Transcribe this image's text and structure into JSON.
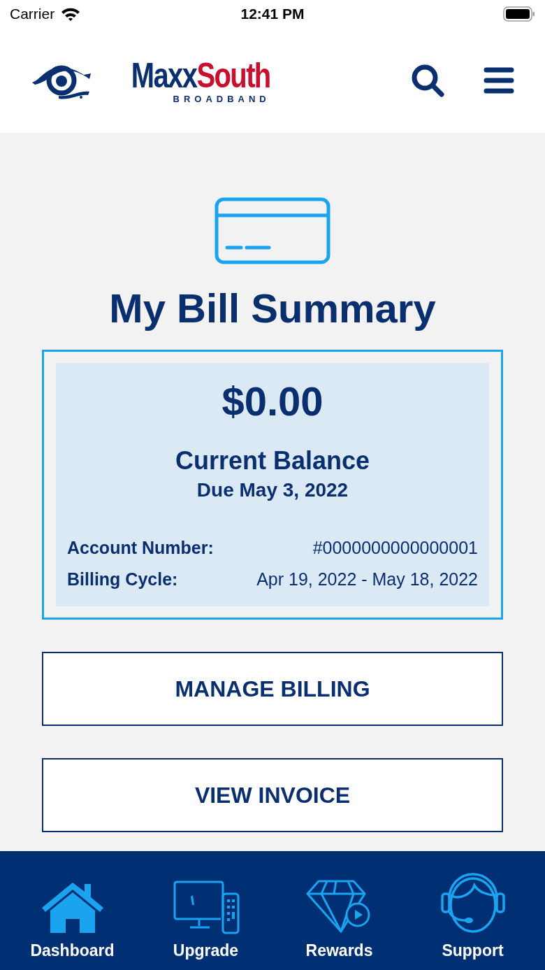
{
  "status_bar": {
    "carrier": "Carrier",
    "time": "12:41 PM"
  },
  "header": {
    "logo": {
      "word_1": "Maxx",
      "word_2": "South",
      "tagline": "BROADBAND"
    }
  },
  "bill": {
    "title": "My Bill Summary",
    "amount": "$0.00",
    "balance_label": "Current Balance",
    "due": "Due May 3, 2022",
    "details": [
      {
        "label": "Account Number:",
        "value": "#0000000000000001"
      },
      {
        "label": "Billing Cycle:",
        "value": "Apr 19, 2022 - May 18, 2022"
      }
    ]
  },
  "actions": [
    "MANAGE BILLING",
    "VIEW INVOICE"
  ],
  "tab_bar": [
    {
      "label": "Dashboard",
      "kind": "home"
    },
    {
      "label": "Upgrade",
      "kind": "tv"
    },
    {
      "label": "Rewards",
      "kind": "gem"
    },
    {
      "label": "Support",
      "kind": "agent"
    }
  ]
}
